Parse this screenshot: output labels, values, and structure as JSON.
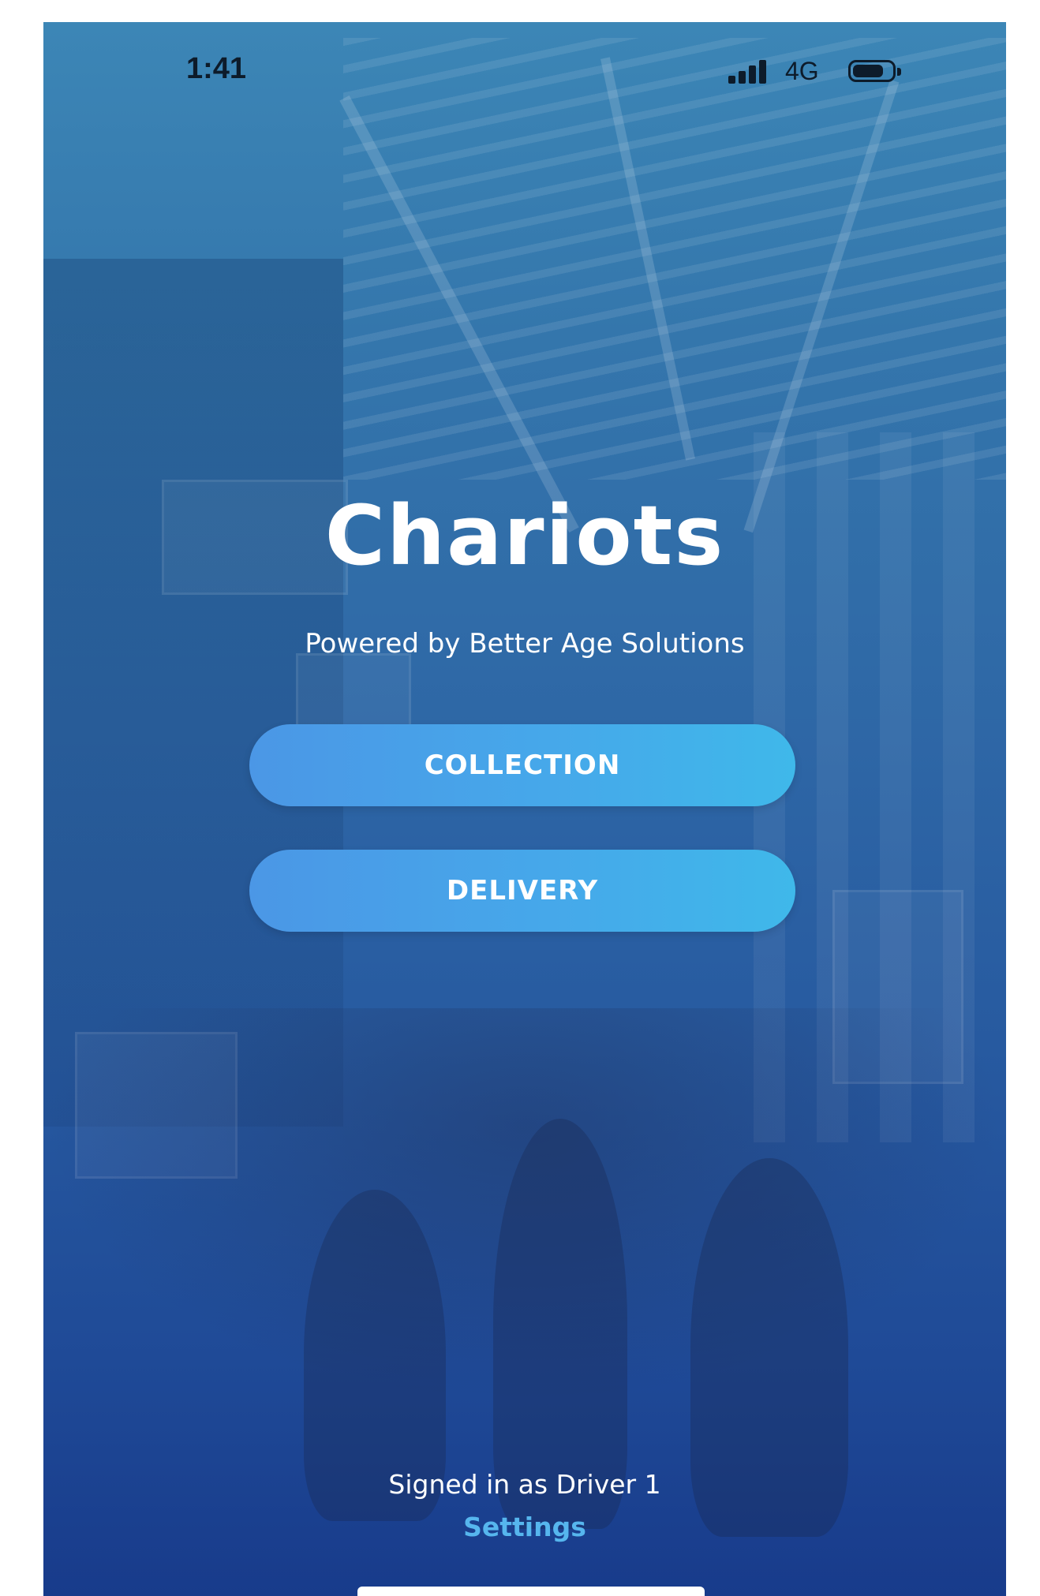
{
  "status_bar": {
    "time": "1:41",
    "network": "4G",
    "icons": [
      "signal-bars-icon",
      "battery-icon"
    ]
  },
  "app": {
    "title": "Chariots",
    "subtitle": "Powered by Better Age Solutions"
  },
  "actions": {
    "collection_label": "COLLECTION",
    "delivery_label": "DELIVERY"
  },
  "footer": {
    "signed_in_text": "Signed in as Driver 1",
    "settings_label": "Settings"
  },
  "colors": {
    "button_gradient_start": "#4b97e6",
    "button_gradient_end": "#3fb8ea",
    "settings_link": "#56b6ee",
    "overlay_top": "#3c86b6",
    "overlay_bottom": "#183b8b"
  }
}
